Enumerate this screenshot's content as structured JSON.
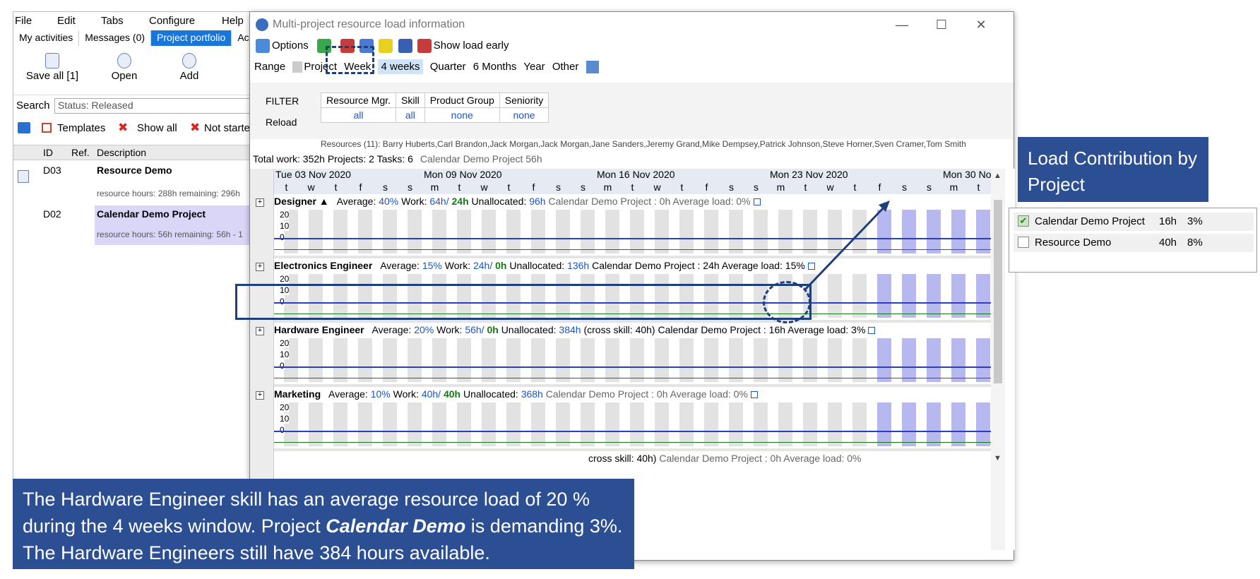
{
  "bg_app": {
    "menu": [
      "File",
      "Edit",
      "Tabs",
      "Configure",
      "Help"
    ],
    "tabs": [
      {
        "label": "My activities",
        "active": false
      },
      {
        "label": "Messages (0)",
        "active": false
      },
      {
        "label": "Project portfolio",
        "active": true
      },
      {
        "label": "Acti",
        "active": false
      }
    ],
    "toolbar": {
      "save_label": "Save all [1]",
      "open_label": "Open",
      "add_label": "Add"
    },
    "search": {
      "label": "Search",
      "value": "Status: Released"
    },
    "toolbar2": {
      "templates": "Templates",
      "show_all": "Show all",
      "not_started": "Not starte"
    },
    "grid": {
      "headers": [
        "ID",
        "Ref.",
        "Description"
      ],
      "rows": [
        {
          "id": "D03",
          "title": "Resource Demo",
          "sub": "resource hours: 288h remaining: 296h"
        },
        {
          "id": "D02",
          "title": "Calendar Demo Project",
          "sub": "resource hours: 56h remaining: 56h - 1"
        }
      ]
    }
  },
  "dialog": {
    "title": "Multi-project resource load information",
    "toolbar": {
      "options": "Options",
      "show_load_early": "Show load early"
    },
    "range": {
      "label": "Range",
      "project": "Project",
      "week": "Week",
      "four_weeks": "4 weeks",
      "quarter": "Quarter",
      "six_months": "6 Months",
      "year": "Year",
      "other": "Other"
    },
    "filter": {
      "label": "FILTER",
      "reload": "Reload",
      "headers": [
        "Resource Mgr.",
        "Skill",
        "Product Group",
        "Seniority"
      ],
      "values": [
        "all",
        "all",
        "none",
        "none"
      ]
    },
    "resources": "Resources (11): Barry Huberts,Carl Brandon,Jack Morgan,Jack Morgan,Jane Sanders,Jeremy Grand,Mike Dempsey,Patrick Johnson,Steve Horner,Sven Cramer,Tom Smith",
    "totals": {
      "text": "Total work: 352h  Projects: 2  Tasks: 6",
      "project_part": "Calendar Demo Project 56h"
    },
    "date_headers": [
      {
        "label": "Tue 03 Nov 2020"
      },
      {
        "label": "Mon 09 Nov 2020"
      },
      {
        "label": "Mon 16 Nov 2020"
      },
      {
        "label": "Mon 23 Nov 2020"
      },
      {
        "label": "Mon 30 No"
      }
    ],
    "days": [
      "t",
      "w",
      "t",
      "f",
      "s",
      "s",
      "m",
      "t",
      "w",
      "t",
      "f",
      "s",
      "s",
      "m",
      "t",
      "w",
      "t",
      "f",
      "s",
      "s",
      "m",
      "t",
      "w",
      "t",
      "f",
      "s",
      "s",
      "m",
      "t"
    ],
    "y_ticks": [
      "20",
      "10",
      "0"
    ],
    "sections": [
      {
        "name": "Designer ▲",
        "avg_label": "Average:",
        "avg": "40%",
        "work_label": "Work:",
        "work": "64h/",
        "work2": "24h",
        "unalloc_label": "Unallocated:",
        "unalloc": "96h",
        "cross": "",
        "proj": "Calendar Demo Project : 0h Average load: 0%"
      },
      {
        "name": "Electronics Engineer",
        "avg_label": "Average:",
        "avg": "15%",
        "work_label": "Work:",
        "work": "24h/",
        "work2": "0h",
        "unalloc_label": "Unallocated:",
        "unalloc": "136h",
        "cross": "",
        "proj": "Calendar Demo Project : 24h Average load: 15%"
      },
      {
        "name": "Hardware Engineer",
        "avg_label": "Average:",
        "avg": "20%",
        "work_label": "Work:",
        "work": "56h/",
        "work2": "0h",
        "unalloc_label": "Unallocated:",
        "unalloc": "384h",
        "cross": "(cross skill: 40h)",
        "proj": "Calendar Demo Project : 16h Average load: 3%"
      },
      {
        "name": "Marketing",
        "avg_label": "Average:",
        "avg": "10%",
        "work_label": "Work:",
        "work": "40h/",
        "work2": "40h",
        "unalloc_label": "Unallocated:",
        "unalloc": "368h",
        "cross": "",
        "proj": "Calendar Demo Project : 0h Average load: 0%"
      }
    ],
    "last_row_fragment": {
      "cross": "cross skill: 40h)",
      "proj": "Calendar Demo Project : 0h Average load: 0%"
    }
  },
  "callout_title": "Load Contribution by Project",
  "legend": [
    {
      "name": "Calendar Demo Project",
      "hours": "16h",
      "pct": "3%",
      "checked": true
    },
    {
      "name": "Resource Demo",
      "hours": "40h",
      "pct": "8%",
      "checked": false
    }
  ],
  "bottom_text": {
    "part1": "The Hardware Engineer skill has an average resource load of 20 % during the 4 weeks window.  Project ",
    "italic": "Calendar Demo",
    "part2": " is demanding 3%.  The Hardware Engineers still have 384 hours available."
  },
  "colors": {
    "accent": "#2c4f94",
    "tab_active": "#1a75d8",
    "load_blue": "#1a55c8",
    "green": "#147a14"
  }
}
